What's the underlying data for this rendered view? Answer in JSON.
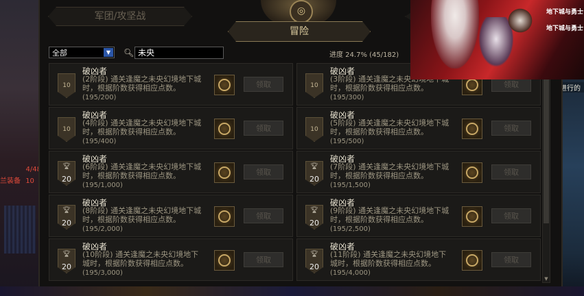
{
  "tabs": {
    "guild": "军团/攻坚战",
    "adventure": "冒险"
  },
  "filter": {
    "category": "全部",
    "search_value": "未央"
  },
  "progress_text": "进度 24.7% (45/182)",
  "side": {
    "left_top": "4/48",
    "left_mid": "兰装备",
    "left_right": "10",
    "right_note": "进行的"
  },
  "banner": {
    "logo_line1": "地下城与勇士",
    "logo_line2": "地下城与勇士"
  },
  "claim_label": "领取",
  "achievements": [
    {
      "title": "破凶者",
      "desc": "(2阶段) 通关逢魔之未央幻境地下城时，根据阶数获得相应点数。",
      "progress": "(195/200)",
      "badge": "10",
      "badge_type": "plain"
    },
    {
      "title": "破凶者",
      "desc": "(3阶段) 通关逢魔之未央幻境地下城时，根据阶数获得相应点数。",
      "progress": "(195/300)",
      "badge": "10",
      "badge_type": "plain"
    },
    {
      "title": "破凶者",
      "desc": "(4阶段) 通关逢魔之未央幻境地下城时，根据阶数获得相应点数。",
      "progress": "(195/400)",
      "badge": "10",
      "badge_type": "plain"
    },
    {
      "title": "破凶者",
      "desc": "(5阶段) 通关逢魔之未央幻境地下城时，根据阶数获得相应点数。",
      "progress": "(195/500)",
      "badge": "10",
      "badge_type": "plain"
    },
    {
      "title": "破凶者",
      "desc": "(6阶段) 通关逢魔之未央幻境地下城时，根据阶数获得相应点数。",
      "progress": "(195/1,000)",
      "badge": "20",
      "badge_type": "gold"
    },
    {
      "title": "破凶者",
      "desc": "(7阶段) 通关逢魔之未央幻境地下城时，根据阶数获得相应点数。",
      "progress": "(195/1,500)",
      "badge": "20",
      "badge_type": "gold"
    },
    {
      "title": "破凶者",
      "desc": "(8阶段) 通关逢魔之未央幻境地下城时，根据阶数获得相应点数。",
      "progress": "(195/2,000)",
      "badge": "20",
      "badge_type": "gold"
    },
    {
      "title": "破凶者",
      "desc": "(9阶段) 通关逢魔之未央幻境地下城时，根据阶数获得相应点数。",
      "progress": "(195/2,500)",
      "badge": "20",
      "badge_type": "gold"
    },
    {
      "title": "破凶者",
      "desc": "(10阶段) 通关逢魔之未央幻境地下城时，根据阶数获得相应点数。",
      "progress": "(195/3,000)",
      "badge": "20",
      "badge_type": "gold"
    },
    {
      "title": "破凶者",
      "desc": "(11阶段) 通关逢魔之未央幻境地下城时，根据阶数获得相应点数。",
      "progress": "(195/4,000)",
      "badge": "20",
      "badge_type": "gold"
    }
  ]
}
